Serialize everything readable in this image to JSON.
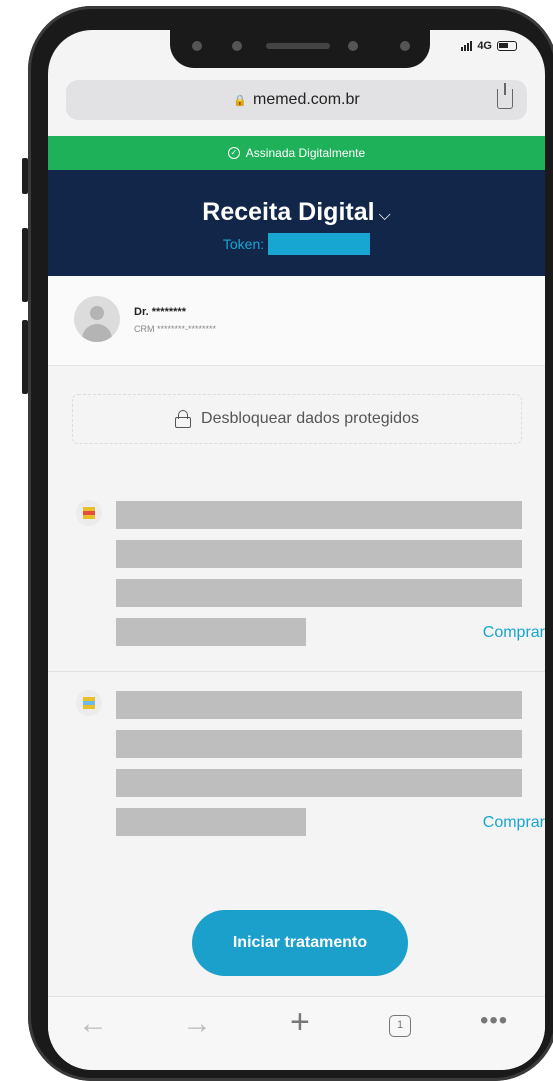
{
  "status_bar": {
    "network": "4G"
  },
  "browser": {
    "url": "memed.com.br"
  },
  "banner": {
    "signed_label": "Assinada Digitalmente"
  },
  "header": {
    "title": "Receita Digital",
    "token_label": "Token:"
  },
  "doctor": {
    "name": "Dr. ********",
    "crm": "CRM ********-********"
  },
  "unlock": {
    "label": "Desbloquear dados protegidos"
  },
  "medications": [
    {
      "buy_label": "Comprar"
    },
    {
      "buy_label": "Comprar"
    }
  ],
  "cta": {
    "label": "Iniciar tratamento"
  },
  "toolbar": {
    "back": "←",
    "forward": "→",
    "new_tab": "+",
    "tabs_count": "1",
    "more": "•••"
  },
  "colors": {
    "signed_green": "#1fb15a",
    "header_navy": "#12264a",
    "accent_blue": "#17a6d2",
    "button_blue": "#1b9fcb"
  }
}
